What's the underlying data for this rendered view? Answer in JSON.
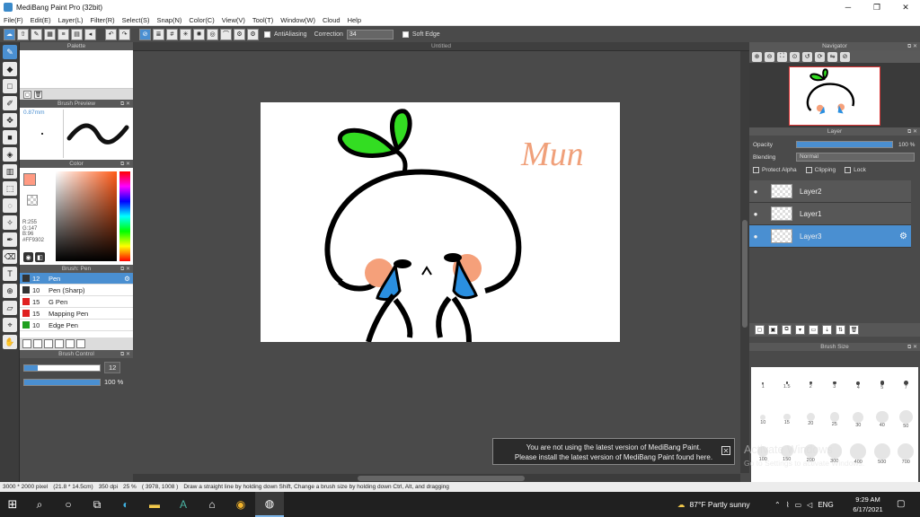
{
  "window": {
    "title": "MediBang Paint Pro (32bit)",
    "minimize": "─",
    "maximize": "❐",
    "close": "✕"
  },
  "menu": [
    "File(F)",
    "Edit(E)",
    "Layer(L)",
    "Filter(R)",
    "Select(S)",
    "Snap(N)",
    "Color(C)",
    "View(V)",
    "Tool(T)",
    "Window(W)",
    "Cloud",
    "Help"
  ],
  "toolbar": {
    "antialias_label": "AntiAliasing",
    "correction_label": "Correction",
    "correction_value": "34",
    "soft_edge_label": "Soft Edge"
  },
  "panels": {
    "palette_title": "Palette",
    "brush_preview_title": "Brush Preview",
    "brush_preview_size": "0.87mm",
    "color_title": "Color",
    "color_values": "R:255\nG:147\nB:96\n#FF9302",
    "brush_title": "Brush: Pen",
    "brush_control_title": "Brush Control",
    "navigator_title": "Navigator",
    "layer_title": "Layer",
    "brush_size_title": "Brush Size"
  },
  "brushes": [
    {
      "size": "12",
      "name": "Pen",
      "color": "#333333",
      "selected": true
    },
    {
      "size": "10",
      "name": "Pen (Sharp)",
      "color": "#333333",
      "selected": false
    },
    {
      "size": "15",
      "name": "G Pen",
      "color": "#e02020",
      "selected": false
    },
    {
      "size": "15",
      "name": "Mapping Pen",
      "color": "#e02020",
      "selected": false
    },
    {
      "size": "10",
      "name": "Edge Pen",
      "color": "#20a020",
      "selected": false
    }
  ],
  "brush_control": {
    "size_value": "12",
    "opacity_value": "100 %",
    "size_fraction": 0.18,
    "opacity_fraction": 1.0
  },
  "canvas": {
    "tab_title": "Untitled",
    "signature": "Mun"
  },
  "layer_props": {
    "opacity_label": "Opacity",
    "opacity_value": "100 %",
    "blending_label": "Blending",
    "blending_value": "Normal",
    "protect_alpha": "Protect Alpha",
    "clipping": "Clipping",
    "lock": "Lock"
  },
  "layers": [
    {
      "name": "Layer2",
      "selected": false
    },
    {
      "name": "Layer1",
      "selected": false
    },
    {
      "name": "Layer3",
      "selected": true
    }
  ],
  "brush_sizes": {
    "row1": [
      "1",
      "1.5",
      "2",
      "3",
      "4",
      "5",
      "7"
    ],
    "row2": [
      "10",
      "15",
      "20",
      "25",
      "30",
      "40",
      "50"
    ],
    "row3": [
      "100",
      "150",
      "200",
      "300",
      "400",
      "500",
      "700"
    ]
  },
  "notice": {
    "line1": "You are not using the latest version of MediBang Paint.",
    "line2": "Please install the latest version of MediBang Paint found here.",
    "close": "✕"
  },
  "watermark": {
    "line1": "Activate Windows",
    "line2": "Go to Settings to activate Windows."
  },
  "status": {
    "size_px": "3000 * 2000 pixel",
    "size_cm": "(21.8 * 14.5cm)",
    "dpi": "350 dpi",
    "zoom": "25 %",
    "coords": "( 3978, 1008 )",
    "hint": "Draw a straight line by holding down Shift, Change a brush size by holding down Ctrl, Alt, and dragging"
  },
  "taskbar": {
    "weather": "87°F  Partly sunny",
    "lang": "ENG",
    "time": "9:29 AM",
    "date": "6/17/2021"
  },
  "colors": {
    "accent": "#4a8fd1",
    "leaf": "#33dd22",
    "blush": "#f5a07a",
    "tear": "#2a8fe0",
    "signature": "#f0a07a"
  }
}
